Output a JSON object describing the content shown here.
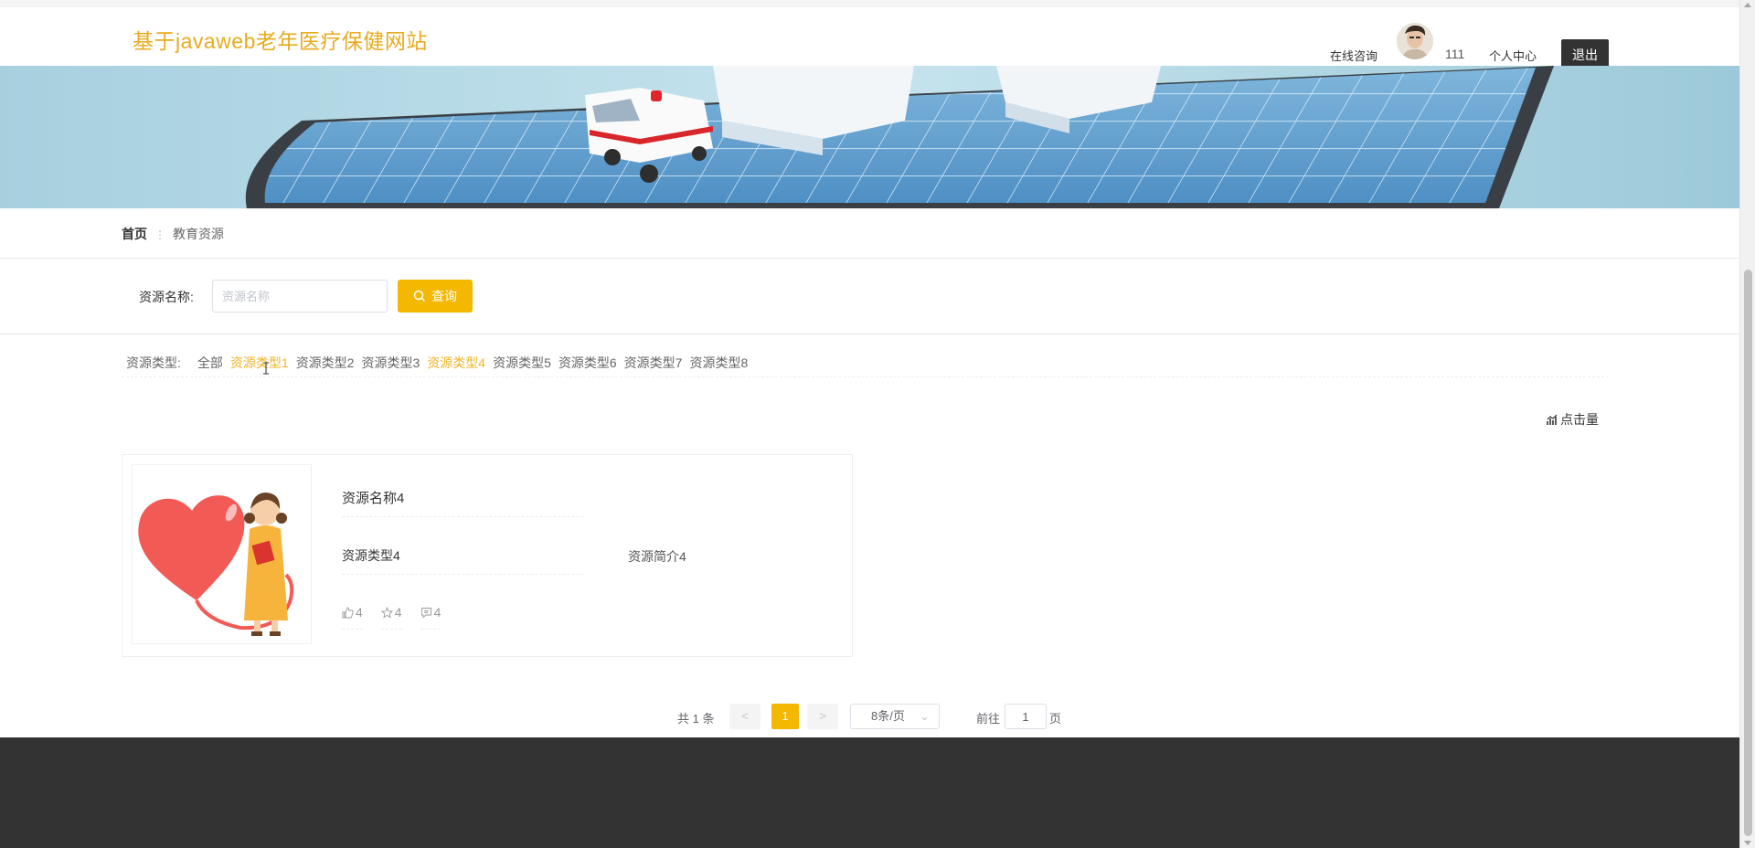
{
  "header": {
    "site_title": "基于javaweb老年医疗保健网站",
    "nav_consult": "在线咨询",
    "username": "111",
    "nav_center": "个人中心",
    "logout_label": "退出"
  },
  "banner": {
    "slide_count": 3,
    "active_slide": 1
  },
  "breadcrumb": {
    "home": "首页",
    "separator": "⋮",
    "current": "教育资源"
  },
  "search": {
    "label": "资源名称:",
    "placeholder": "资源名称",
    "button_label": "查询"
  },
  "types": {
    "label": "资源类型:",
    "items": [
      {
        "label": "全部",
        "active": false
      },
      {
        "label": "资源类型1",
        "active": true
      },
      {
        "label": "资源类型2",
        "active": false
      },
      {
        "label": "资源类型3",
        "active": false
      },
      {
        "label": "资源类型4",
        "active": true
      },
      {
        "label": "资源类型5",
        "active": false
      },
      {
        "label": "资源类型6",
        "active": false
      },
      {
        "label": "资源类型7",
        "active": false
      },
      {
        "label": "资源类型8",
        "active": false
      }
    ]
  },
  "sort": {
    "label": "点击量"
  },
  "card": {
    "title": "资源名称4",
    "type": "资源类型4",
    "intro": "资源简介4",
    "likes": "4",
    "favorites": "4",
    "comments": "4"
  },
  "pagination": {
    "total": "共 1 条",
    "prev": "<",
    "current_page": "1",
    "next": ">",
    "page_size": "8条/页",
    "goto_label": "前往",
    "goto_value": "1",
    "page_suffix": "页"
  },
  "colors": {
    "accent": "#f4b800",
    "title": "#e8ab1f",
    "footer": "#333333"
  }
}
